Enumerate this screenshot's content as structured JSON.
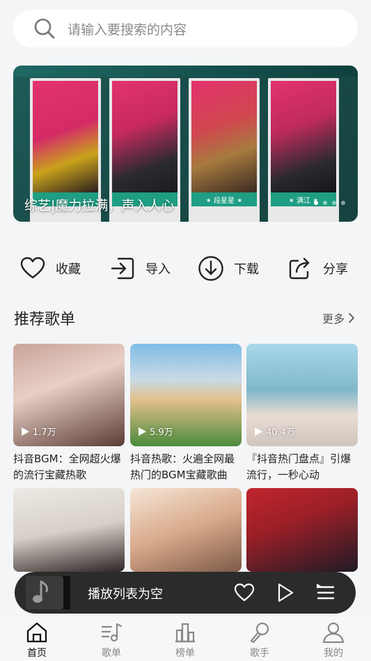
{
  "search": {
    "placeholder": "请输入要搜索的内容",
    "icon": "search-icon"
  },
  "banner": {
    "caption": "综艺|魔力拉满，声入人心",
    "cards": [
      {
        "name": ""
      },
      {
        "name": ""
      },
      {
        "name": "✶ 段星星 ✶"
      },
      {
        "name": "✶ 满江 ✶"
      }
    ],
    "dots": 4,
    "active_dot": 0
  },
  "actions": [
    {
      "label": "收藏",
      "icon": "heart-icon"
    },
    {
      "label": "导入",
      "icon": "import-icon"
    },
    {
      "label": "下载",
      "icon": "download-icon"
    },
    {
      "label": "分享",
      "icon": "share-icon"
    }
  ],
  "section": {
    "title": "推荐歌单",
    "more": "更多"
  },
  "playlists": [
    {
      "count": "1.7万",
      "title": "抖音BGM：全网超火爆的流行宝藏热歌",
      "palette": [
        "#d9a7a0",
        "#3b2a2a"
      ]
    },
    {
      "count": "5.9万",
      "title": "抖音热歌：火遍全网最热门的BGM宝藏歌曲",
      "palette": [
        "#8cc6e8",
        "#d7b47a"
      ]
    },
    {
      "count": "40.4万",
      "title": "『抖音热门盘点』引爆流行，一秒心动",
      "palette": [
        "#8fc9d8",
        "#f1e2d9"
      ]
    },
    {
      "count": "",
      "title": "",
      "palette": [
        "#e9e5e0",
        "#2a2222"
      ]
    },
    {
      "count": "",
      "title": "",
      "palette": [
        "#f3e0cf",
        "#b98b6c"
      ]
    },
    {
      "count": "",
      "title": "",
      "palette": [
        "#b3262b",
        "#1d1a24"
      ]
    }
  ],
  "player": {
    "text": "播放列表为空"
  },
  "tabs": [
    {
      "label": "首页",
      "icon": "home-icon",
      "active": true
    },
    {
      "label": "歌单",
      "icon": "playlist-icon",
      "active": false
    },
    {
      "label": "榜单",
      "icon": "chart-icon",
      "active": false
    },
    {
      "label": "歌手",
      "icon": "microphone-icon",
      "active": false
    },
    {
      "label": "我的",
      "icon": "user-icon",
      "active": false
    }
  ]
}
